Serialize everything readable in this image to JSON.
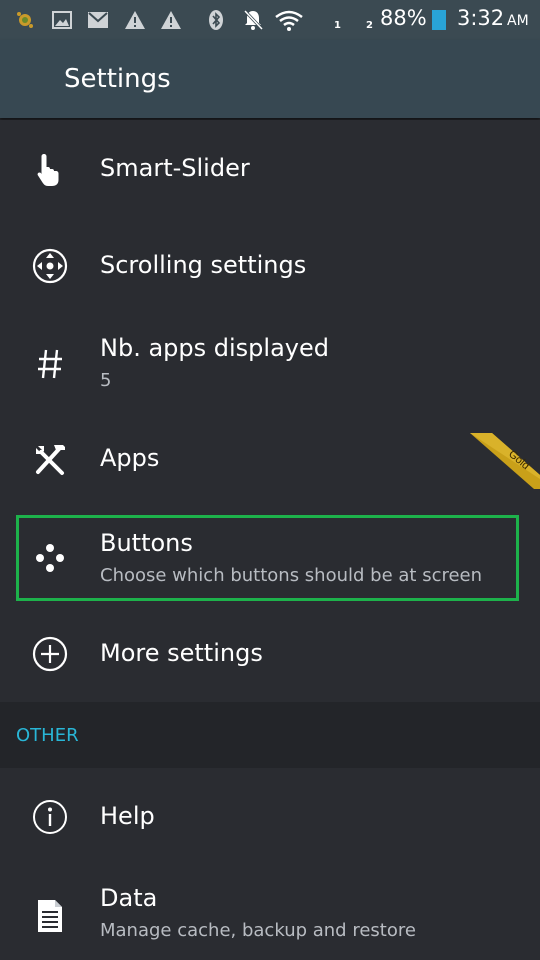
{
  "status_bar": {
    "battery_percent": "88%",
    "time": "3:32",
    "ampm": "AM",
    "sim1": "1",
    "sim2": "2",
    "icons": [
      "app-notification-icon",
      "image-icon",
      "gmail-icon",
      "warning-icon",
      "warning-icon",
      "bluetooth-icon",
      "mute-icon",
      "wifi-icon",
      "signal-icon",
      "battery-icon"
    ]
  },
  "appbar": {
    "title": "Settings"
  },
  "settings": {
    "items": [
      {
        "icon": "touch-icon",
        "title": "Smart-Slider"
      },
      {
        "icon": "scroll-icon",
        "title": "Scrolling settings"
      },
      {
        "icon": "hash-icon",
        "title": "Nb. apps displayed",
        "subtitle": "5",
        "badge": "Gold"
      },
      {
        "icon": "tools-icon",
        "title": "Apps"
      },
      {
        "icon": "buttons-icon",
        "title": "Buttons",
        "subtitle": "Choose which buttons should be at screen"
      },
      {
        "icon": "add-circle-icon",
        "title": "More settings"
      }
    ]
  },
  "other": {
    "header": "OTHER",
    "items": [
      {
        "icon": "info-icon",
        "title": "Help"
      },
      {
        "icon": "document-icon",
        "title": "Data",
        "subtitle": "Manage cache, backup and restore"
      }
    ]
  },
  "colors": {
    "highlight": "#1db24b",
    "section_header": "#29b6d6",
    "gold": "#c9a019"
  }
}
